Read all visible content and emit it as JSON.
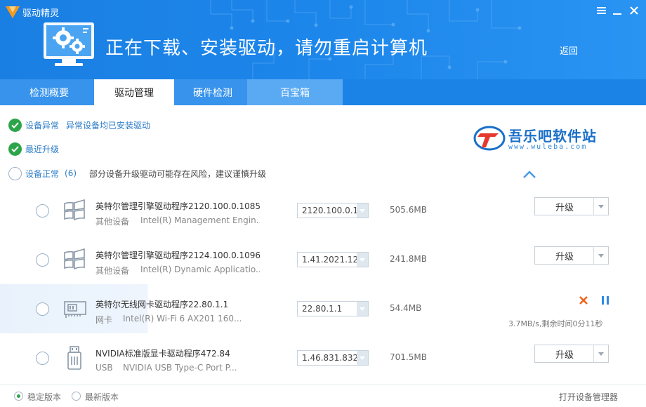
{
  "window": {
    "app_title": "驱动精灵",
    "menu_icon": "menu-icon",
    "minimize_icon": "minimize-icon",
    "close_icon": "close-icon"
  },
  "banner": {
    "headline": "正在下载、安装驱动，请勿重启计算机",
    "back_label": "返回"
  },
  "tabs": [
    {
      "label": "检测概要",
      "active": false
    },
    {
      "label": "驱动管理",
      "active": true
    },
    {
      "label": "硬件检测",
      "active": false
    },
    {
      "label": "百宝箱",
      "active": false
    }
  ],
  "status": {
    "abnormal_label": "设备异常",
    "abnormal_note": "异常设备均已安装驱动",
    "recent_label": "最近升级",
    "normal_label": "设备正常",
    "normal_count": "(6)",
    "normal_warning": "部分设备升级驱动可能存在风险，建议谨慎升级"
  },
  "watermark": {
    "name": "吾乐吧软件站",
    "url": "www.wuleba.com"
  },
  "drivers": [
    {
      "name": "英特尔管理引擎驱动程序2120.100.0.1085",
      "category": "其他设备",
      "device": "Intel(R) Management Engin...",
      "version": "2120.100.0.1",
      "size": "505.6MB",
      "action": "升级",
      "icon": "windows-logo-icon"
    },
    {
      "name": "英特尔管理引擎驱动程序2124.100.0.1096",
      "category": "其他设备",
      "device": "Intel(R) Dynamic Applicatio...",
      "version": "1.41.2021.12",
      "size": "241.8MB",
      "action": "升级",
      "icon": "windows-logo-icon"
    },
    {
      "name": "英特尔无线网卡驱动程序22.80.1.1",
      "category": "网卡",
      "device": "Intel(R) Wi-Fi 6 AX201 160...",
      "version": "22.80.1.1",
      "size": "54.4MB",
      "progress": "3.7MB/s,剩余时间0分11秒",
      "icon": "network-card-icon"
    },
    {
      "name": "NVIDIA标准版显卡驱动程序472.84",
      "category": "USB",
      "device": "NVIDIA USB Type-C Port P...",
      "version": "1.46.831.832",
      "size": "701.5MB",
      "action": "升级",
      "icon": "usb-icon"
    }
  ],
  "footer": {
    "stable_label": "稳定版本",
    "latest_label": "最新版本",
    "device_manager_link": "打开设备管理器",
    "selected": "stable"
  },
  "colors": {
    "header_blue": "#1d86ea",
    "check_green": "#2da44a",
    "link_blue": "#2e7dc8",
    "cancel_orange": "#f0641e"
  }
}
